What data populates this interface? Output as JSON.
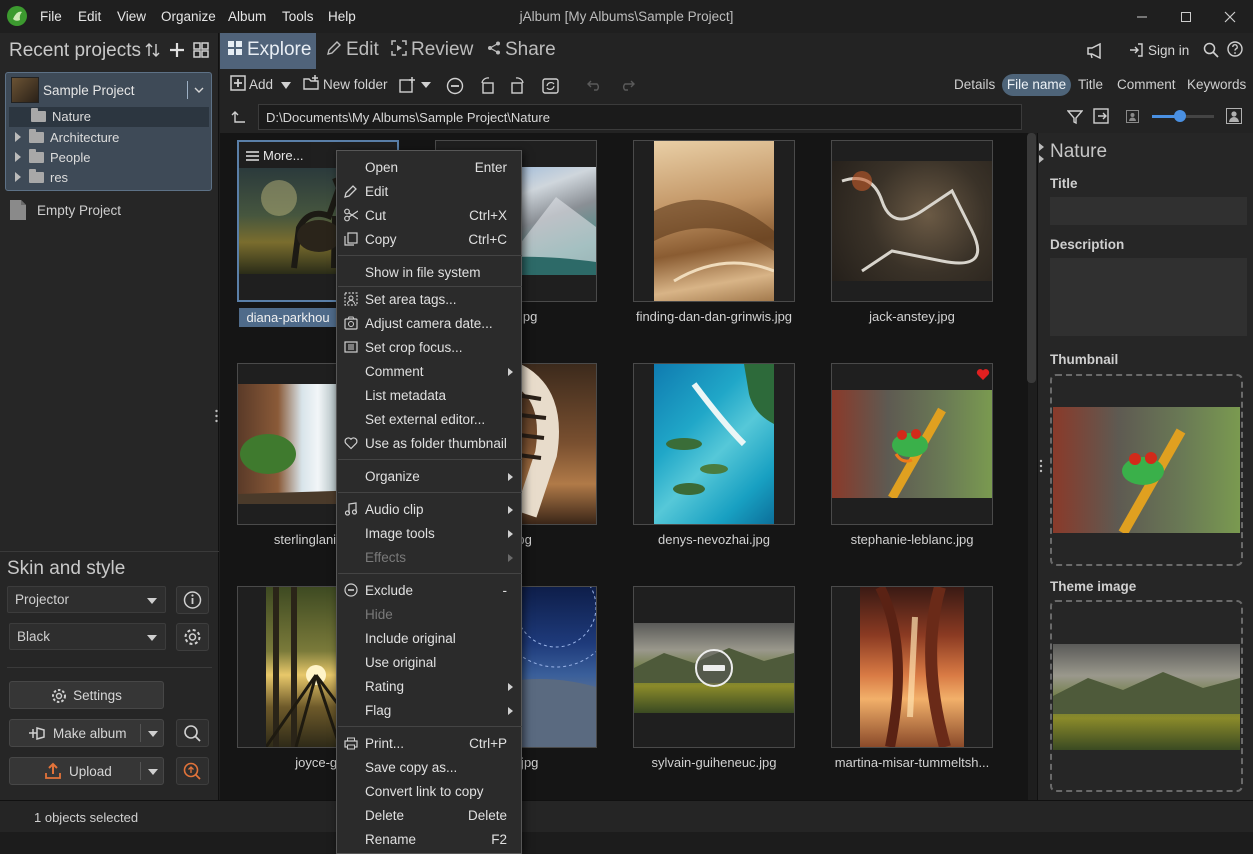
{
  "window": {
    "title": "jAlbum [My Albums\\Sample Project]",
    "menu": [
      "File",
      "Edit",
      "View",
      "Organize",
      "Album",
      "Tools",
      "Help"
    ]
  },
  "left": {
    "recent_projects_label": "Recent projects",
    "project_name": "Sample Project",
    "folders": [
      "Nature",
      "Architecture",
      "People",
      "res"
    ],
    "empty_project": "Empty Project",
    "skin_style_label": "Skin and style",
    "skin": "Projector",
    "style": "Black",
    "settings_label": "Settings",
    "make_album_label": "Make album",
    "upload_label": "Upload"
  },
  "tabs": {
    "explore": "Explore",
    "edit": "Edit",
    "review": "Review",
    "share": "Share",
    "sign_in": "Sign in"
  },
  "toolbar": {
    "add": "Add",
    "new_folder": "New folder",
    "sort_options": [
      "Details",
      "File name",
      "Title",
      "Comment",
      "Keywords"
    ],
    "active_sort": "File name",
    "path": "D:\\Documents\\My Albums\\Sample Project\\Nature",
    "zoom_level": 0.45
  },
  "grid": {
    "more_label": "More...",
    "items": [
      {
        "name": "diana-parkhouse.jpg",
        "caption": "diana-parkhou",
        "selected": true
      },
      {
        "name": "etienne.jpg",
        "caption": "nne.jpg"
      },
      {
        "name": "finding-dan-dan-grinwis.jpg",
        "caption": "finding-dan-dan-grinwis.jpg"
      },
      {
        "name": "jack-anstey.jpg",
        "caption": "jack-anstey.jpg"
      },
      {
        "name": "sterlinglanier-lanier.jpg",
        "caption": "sterlinglanier-la"
      },
      {
        "name": "zebra.jpg",
        "caption": "er.jpg"
      },
      {
        "name": "denys-nevozhai.jpg",
        "caption": "denys-nevozhai.jpg"
      },
      {
        "name": "stephanie-leblanc.jpg",
        "caption": "stephanie-leblanc.jpg",
        "favorite": true
      },
      {
        "name": "joyce-g.jpg",
        "caption": "joyce-g."
      },
      {
        "name": "kina.jpg",
        "caption": "kina.jpg"
      },
      {
        "name": "sylvain-guiheneuc.jpg",
        "caption": "sylvain-guiheneuc.jpg",
        "excluded": true
      },
      {
        "name": "martina-misar-tummeltshammer.jpg",
        "caption": "martina-misar-tummeltsh..."
      }
    ]
  },
  "right": {
    "folder_name": "Nature",
    "title_label": "Title",
    "description_label": "Description",
    "thumbnail_label": "Thumbnail",
    "theme_image_label": "Theme image"
  },
  "status": {
    "text": "1 objects selected"
  },
  "context_menu": {
    "items": [
      {
        "label": "Open",
        "shortcut": "Enter"
      },
      {
        "label": "Edit",
        "icon": "pencil-icon"
      },
      {
        "label": "Cut",
        "shortcut": "Ctrl+X",
        "icon": "scissors-icon"
      },
      {
        "label": "Copy",
        "shortcut": "Ctrl+C",
        "icon": "copy-icon"
      },
      {
        "label": "Show in file system"
      },
      {
        "label": "Set area tags...",
        "icon": "area-tag-icon"
      },
      {
        "label": "Adjust camera date...",
        "icon": "clock-icon"
      },
      {
        "label": "Set crop focus...",
        "icon": "crop-focus-icon"
      },
      {
        "label": "Comment",
        "submenu": true
      },
      {
        "label": "List metadata"
      },
      {
        "label": "Set external editor..."
      },
      {
        "label": "Use as folder thumbnail",
        "icon": "heart-icon"
      },
      {
        "label": "Organize",
        "submenu": true
      },
      {
        "label": "Audio clip",
        "submenu": true,
        "icon": "music-note-icon"
      },
      {
        "label": "Image tools",
        "submenu": true
      },
      {
        "label": "Effects",
        "submenu": true,
        "disabled": true
      },
      {
        "label": "Exclude",
        "shortcut": "-",
        "icon": "exclude-icon"
      },
      {
        "label": "Hide",
        "disabled": true
      },
      {
        "label": "Include original"
      },
      {
        "label": "Use original"
      },
      {
        "label": "Rating",
        "submenu": true
      },
      {
        "label": "Flag",
        "submenu": true
      },
      {
        "label": "Print...",
        "shortcut": "Ctrl+P",
        "icon": "printer-icon"
      },
      {
        "label": "Save copy as..."
      },
      {
        "label": "Convert link to copy"
      },
      {
        "label": "Delete",
        "shortcut": "Delete"
      },
      {
        "label": "Rename",
        "shortcut": "F2"
      }
    ]
  },
  "colors": {
    "accent": "#50637a",
    "active_sort": "#4e6479",
    "selection": "#5a7fa8",
    "slider": "#4a90e2",
    "favorite": "#e02020"
  }
}
